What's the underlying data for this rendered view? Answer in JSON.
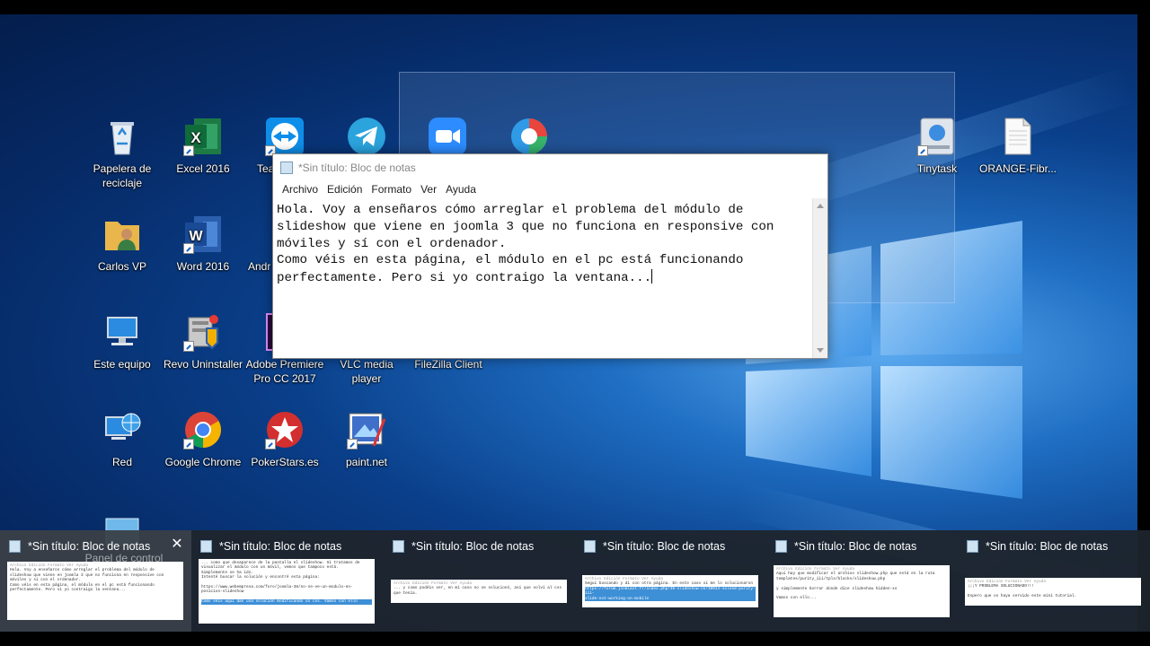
{
  "desktop": {
    "icons": [
      {
        "name": "recycle-bin",
        "label": "Papelera de\nreciclaje"
      },
      {
        "name": "excel",
        "label": "Excel 2016"
      },
      {
        "name": "teamviewer",
        "label": "Tea"
      },
      {
        "name": "user-folder",
        "label": "Carlos VP"
      },
      {
        "name": "word",
        "label": "Word 2016"
      },
      {
        "name": "android",
        "label": "Andr"
      },
      {
        "name": "this-pc",
        "label": "Este equipo"
      },
      {
        "name": "revo",
        "label": "Revo Uninstaller"
      },
      {
        "name": "premiere",
        "label": "Adobe Premiere\nPro CC 2017"
      },
      {
        "name": "vlc",
        "label": "VLC media\nplayer"
      },
      {
        "name": "filezilla",
        "label": "FileZilla Client"
      },
      {
        "name": "network",
        "label": "Red"
      },
      {
        "name": "chrome",
        "label": "Google Chrome"
      },
      {
        "name": "pokerstars",
        "label": "PokerStars.es"
      },
      {
        "name": "paint",
        "label": "paint.net"
      },
      {
        "name": "tinytask",
        "label": "Tinytask"
      },
      {
        "name": "orange",
        "label": "ORANGE-Fibr..."
      }
    ],
    "panel_label": "Panel de control"
  },
  "notepad": {
    "title": "*Sin título: Bloc de notas",
    "menu": [
      "Archivo",
      "Edición",
      "Formato",
      "Ver",
      "Ayuda"
    ],
    "content": "Hola. Voy a enseñaros cómo arreglar el problema del módulo de\nslideshow que viene en joomla 3 que no funciona en responsive con\nmóviles y sí con el ordenador.\nComo véis en esta página, el módulo en el pc está funcionando\nperfectamente. Pero si yo contraigo la ventana..."
  },
  "taskbar_thumbnails": [
    {
      "title": "*Sin título: Bloc de notas",
      "active": true,
      "preview": [
        "Archivo Edición Formato Ver Ayuda",
        "Hola. Voy a enseñaros cómo arreglar el problema del módulo de",
        "slideshow que viene en joomla 3 que no funciona en responsive con",
        "móviles y sí con el ordenador.",
        "Como véis en esta página, el módulo en el pc está funcionando",
        "perfectamente. Pero si yo contraigo la ventana..."
      ]
    },
    {
      "title": "*Sin título: Bloc de notas",
      "active": false,
      "preview": [
        "... como que desaparece de la pantalla el slideshow. Si tratamos de",
        "visualizar el módulo con un móvil, vemos que tampoco está.",
        "Simplemente se ha ido.",
        "Intenté buscar la solución y encontré esta página:",
        "",
        "https://www.webempresa.com/foro/joomla-38/no-se-ve-un-modulo-en-",
        "posicion-slideshow",
        "",
        "Como véis aquí dan una solución modificando un css. Vamos con ello"
      ]
    },
    {
      "title": "*Sin título: Bloc de notas",
      "active": false,
      "preview": [
        "Archivo Edición Formato Ver Ayuda",
        "... y como podéis ver, en mi caso no se solucionó, así que volví al css",
        "que tenía."
      ]
    },
    {
      "title": "*Sin título: Bloc de notas",
      "active": false,
      "preview": [
        "Archivo Edición Formato Ver Ayuda",
        "Seguí buscando y di con otra página. En este caso sí me lo solucionaron",
        "https://forum.joomlaxt.fr/index.php/35-slideshow-ck/38014-solved-purity-iii-",
        "slide-not-working-on-mobile"
      ]
    },
    {
      "title": "*Sin título: Bloc de notas",
      "active": false,
      "preview": [
        "Archivo Edición Formato Ver Ayuda",
        "Aquí hay que modificar el archivo slideshow.php que está en la ruta",
        "templates/purity_iii/tpls/blocks/slideshow.php",
        "",
        "y simplemente borrar donde dice slideshow hidden-xs",
        "",
        "Vamos con ello..."
      ]
    },
    {
      "title": "*Sin título: Bloc de notas",
      "active": false,
      "preview": [
        "Archivo Edición Formato Ver Ayuda",
        "¡¡¡Y PROBLEMA SOLUCIONADO!!!",
        "",
        "Espero que os haya servido este mini tutorial."
      ]
    }
  ]
}
